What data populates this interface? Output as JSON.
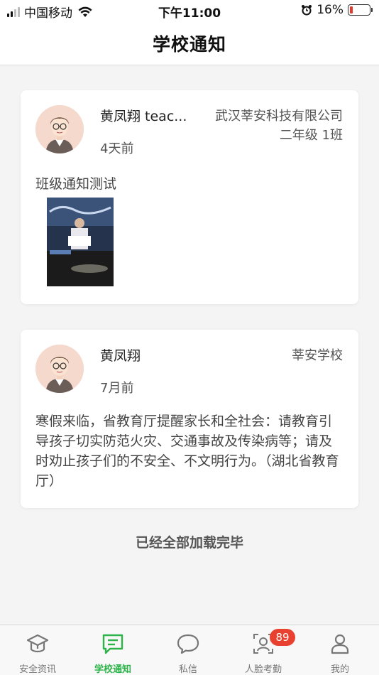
{
  "status_bar": {
    "carrier": "中国移动",
    "time": "下午11:00",
    "battery": "16%",
    "battery_level": 0.16
  },
  "header": {
    "title": "学校通知"
  },
  "notices": [
    {
      "author": "黄凤翔 teac...",
      "time": "4天前",
      "org": "武汉莘安科技有限公司",
      "class_name": "二年级 1班",
      "body": "班级通知测试",
      "has_image": true
    },
    {
      "author": "黄凤翔",
      "time": "7月前",
      "org": "莘安学校",
      "body": "寒假来临，省教育厅提醒家长和全社会：请教育引导孩子切实防范火灾、交通事故及传染病等；请及时劝止孩子们的不安全、不文明行为。（湖北省教育厅）"
    }
  ],
  "load_complete": "已经全部加载完毕",
  "tabs": [
    {
      "label": "安全资讯",
      "icon": "graduation-cap-icon"
    },
    {
      "label": "学校通知",
      "icon": "message-icon",
      "active": true
    },
    {
      "label": "私信",
      "icon": "chat-bubble-icon"
    },
    {
      "label": "人脸考勤",
      "icon": "face-attendance-icon",
      "badge": "89"
    },
    {
      "label": "我的",
      "icon": "person-icon"
    }
  ],
  "colors": {
    "accent": "#2db34a",
    "badge": "#e8412f",
    "background": "#f4f4f4"
  }
}
